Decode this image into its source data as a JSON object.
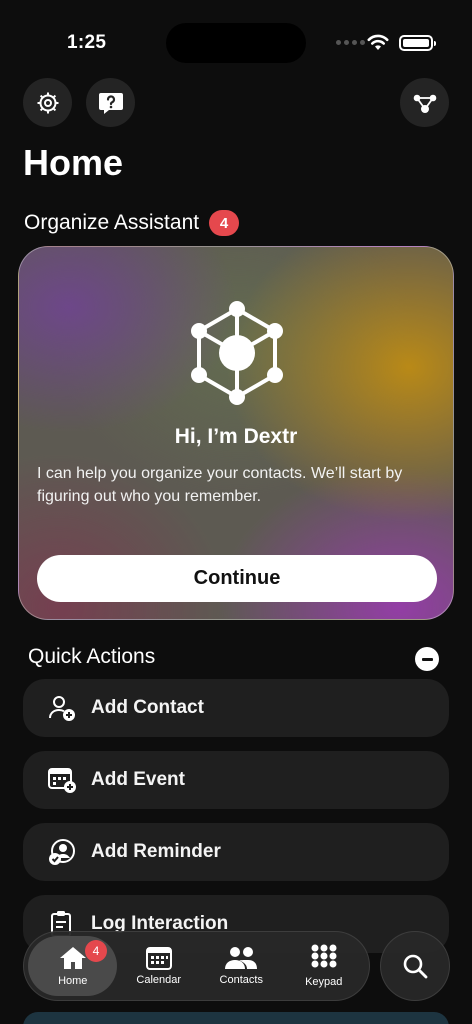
{
  "status_bar": {
    "time": "1:25"
  },
  "page": {
    "title": "Home"
  },
  "organize_assistant": {
    "heading": "Organize Assistant",
    "badge_count": "4",
    "card": {
      "title": "Hi, I’m Dextr",
      "body": "I can help you organize your contacts. We’ll start by figuring out who you remember.",
      "button_label": "Continue"
    }
  },
  "quick_actions": {
    "heading": "Quick Actions",
    "items": [
      {
        "label": "Add Contact",
        "icon": "add-contact-icon"
      },
      {
        "label": "Add Event",
        "icon": "add-event-icon"
      },
      {
        "label": "Add Reminder",
        "icon": "add-reminder-icon"
      },
      {
        "label": "Log Interaction",
        "icon": "clipboard-icon"
      }
    ]
  },
  "tab_bar": {
    "tabs": [
      {
        "label": "Home",
        "icon": "house-icon",
        "badge": "4",
        "active": true
      },
      {
        "label": "Calendar",
        "icon": "calendar-icon"
      },
      {
        "label": "Contacts",
        "icon": "people-icon"
      },
      {
        "label": "Keypad",
        "icon": "keypad-icon"
      }
    ]
  },
  "colors": {
    "background": "#0d0d0d",
    "badge": "#e5484d",
    "row": "#1f1f1f"
  }
}
